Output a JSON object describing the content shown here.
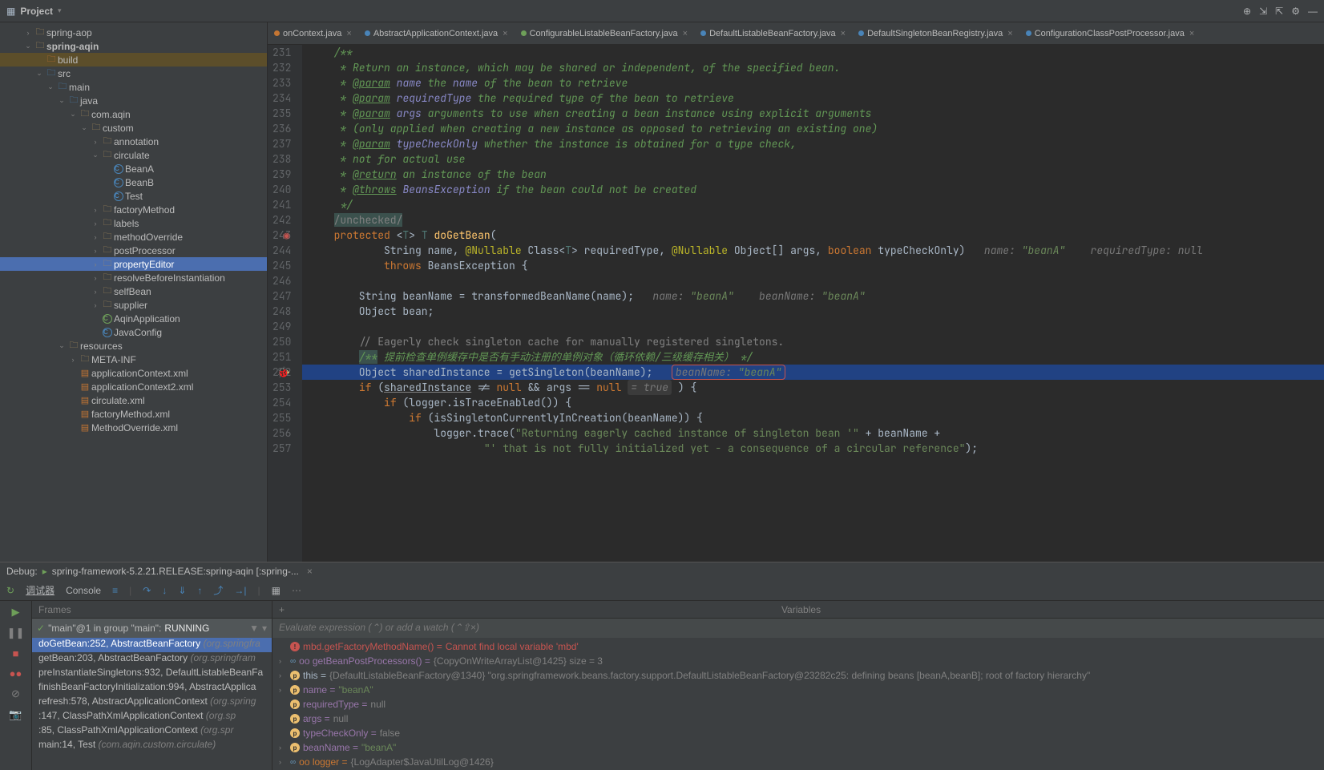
{
  "toolbar": {
    "project_label": "Project"
  },
  "tree": {
    "items": [
      {
        "indent": 2,
        "chev": "›",
        "icon": "folder",
        "label": "spring-aop",
        "cls": ""
      },
      {
        "indent": 2,
        "chev": "⌄",
        "icon": "folder",
        "label": "spring-aqin",
        "cls": "",
        "bold": true
      },
      {
        "indent": 3,
        "chev": "",
        "icon": "folder-o",
        "label": "build",
        "cls": "build"
      },
      {
        "indent": 3,
        "chev": "⌄",
        "icon": "folder-b",
        "label": "src",
        "cls": ""
      },
      {
        "indent": 4,
        "chev": "⌄",
        "icon": "folder-b",
        "label": "main",
        "cls": ""
      },
      {
        "indent": 5,
        "chev": "⌄",
        "icon": "folder-b",
        "label": "java",
        "cls": ""
      },
      {
        "indent": 6,
        "chev": "⌄",
        "icon": "folder",
        "label": "com.aqin",
        "cls": ""
      },
      {
        "indent": 7,
        "chev": "⌄",
        "icon": "folder",
        "label": "custom",
        "cls": ""
      },
      {
        "indent": 8,
        "chev": "›",
        "icon": "folder",
        "label": "annotation",
        "cls": ""
      },
      {
        "indent": 8,
        "chev": "⌄",
        "icon": "folder",
        "label": "circulate",
        "cls": ""
      },
      {
        "indent": 9,
        "chev": "",
        "icon": "class",
        "label": "BeanA",
        "cls": ""
      },
      {
        "indent": 9,
        "chev": "",
        "icon": "class",
        "label": "BeanB",
        "cls": ""
      },
      {
        "indent": 9,
        "chev": "",
        "icon": "class",
        "label": "Test",
        "cls": ""
      },
      {
        "indent": 8,
        "chev": "›",
        "icon": "folder",
        "label": "factoryMethod",
        "cls": ""
      },
      {
        "indent": 8,
        "chev": "›",
        "icon": "folder",
        "label": "labels",
        "cls": ""
      },
      {
        "indent": 8,
        "chev": "›",
        "icon": "folder",
        "label": "methodOverride",
        "cls": ""
      },
      {
        "indent": 8,
        "chev": "›",
        "icon": "folder",
        "label": "postProcessor",
        "cls": ""
      },
      {
        "indent": 8,
        "chev": "›",
        "icon": "folder",
        "label": "propertyEditor",
        "cls": "sel"
      },
      {
        "indent": 8,
        "chev": "›",
        "icon": "folder",
        "label": "resolveBeforeInstantiation",
        "cls": ""
      },
      {
        "indent": 8,
        "chev": "›",
        "icon": "folder",
        "label": "selfBean",
        "cls": ""
      },
      {
        "indent": 8,
        "chev": "›",
        "icon": "folder",
        "label": "supplier",
        "cls": ""
      },
      {
        "indent": 8,
        "chev": "",
        "icon": "class-g",
        "label": "AqinApplication",
        "cls": ""
      },
      {
        "indent": 8,
        "chev": "",
        "icon": "class",
        "label": "JavaConfig",
        "cls": ""
      },
      {
        "indent": 5,
        "chev": "⌄",
        "icon": "folder",
        "label": "resources",
        "cls": ""
      },
      {
        "indent": 6,
        "chev": "›",
        "icon": "folder",
        "label": "META-INF",
        "cls": ""
      },
      {
        "indent": 6,
        "chev": "",
        "icon": "xml",
        "label": "applicationContext.xml",
        "cls": ""
      },
      {
        "indent": 6,
        "chev": "",
        "icon": "xml",
        "label": "applicationContext2.xml",
        "cls": ""
      },
      {
        "indent": 6,
        "chev": "",
        "icon": "xml",
        "label": "circulate.xml",
        "cls": ""
      },
      {
        "indent": 6,
        "chev": "",
        "icon": "xml",
        "label": "factoryMethod.xml",
        "cls": ""
      },
      {
        "indent": 6,
        "chev": "",
        "icon": "xml",
        "label": "MethodOverride.xml",
        "cls": ""
      }
    ]
  },
  "tabs": [
    {
      "dot": "o",
      "label": "onContext.java"
    },
    {
      "dot": "b",
      "label": "AbstractApplicationContext.java"
    },
    {
      "dot": "g",
      "label": "ConfigurableListableBeanFactory.java"
    },
    {
      "dot": "b",
      "label": "DefaultListableBeanFactory.java"
    },
    {
      "dot": "b",
      "label": "DefaultSingletonBeanRegistry.java"
    },
    {
      "dot": "b",
      "label": "ConfigurationClassPostProcessor.java"
    }
  ],
  "code": {
    "first_line": 231,
    "breakpoint_line": 252,
    "lines": [
      "    /**",
      "     * Return an instance, which may be shared or independent, of the specified bean.",
      "     * @param name the name of the bean to retrieve",
      "     * @param requiredType the required type of the bean to retrieve",
      "     * @param args arguments to use when creating a bean instance using explicit arguments",
      "     * (only applied when creating a new instance as opposed to retrieving an existing one)",
      "     * @param typeCheckOnly whether the instance is obtained for a type check,",
      "     * not for actual use",
      "     * @return an instance of the bean",
      "     * @throws BeansException if the bean could not be created",
      "     */",
      "    /unchecked/",
      "    protected <T> T doGetBean(",
      "            String name, @Nullable Class<T> requiredType, @Nullable Object[] args, boolean typeCheckOnly)   name: \"beanA\"    requiredType: null",
      "            throws BeansException {",
      "",
      "        String beanName = transformedBeanName(name);   name: \"beanA\"    beanName: \"beanA\"",
      "        Object bean;",
      "",
      "        // Eagerly check singleton cache for manually registered singletons.",
      "        /** 提前检查单例缓存中是否有手动注册的单例对象（循环依赖/三级缓存相关） */",
      "        Object sharedInstance = getSingleton(beanName);   beanName: \"beanA\"",
      "        if (sharedInstance != null && args == null = true ) {",
      "            if (logger.isTraceEnabled()) {",
      "                if (isSingletonCurrentlyInCreation(beanName)) {",
      "                    logger.trace(\"Returning eagerly cached instance of singleton bean '\" + beanName +",
      "                            \"' that is not fully initialized yet - a consequence of a circular reference\");"
    ]
  },
  "debug": {
    "title": "spring-framework-5.2.21.RELEASE:spring-aqin [:spring-...",
    "tab_debugger": "调试器",
    "tab_console": "Console",
    "frames_hdr": "Frames",
    "vars_hdr": "Variables",
    "thread": {
      "name": "\"main\"@1 in group \"main\":",
      "status": "RUNNING"
    },
    "eval_placeholder": "Evaluate expression (⌃) or add a watch (⌃⇧×)",
    "frames": [
      {
        "main": "doGetBean:252, AbstractBeanFactory",
        "dim": "(org.springfra",
        "sel": true
      },
      {
        "main": "getBean:203, AbstractBeanFactory",
        "dim": "(org.springfram",
        "sel": false
      },
      {
        "main": "preInstantiateSingletons:932, DefaultListableBeanFa",
        "dim": "",
        "sel": false
      },
      {
        "main": "finishBeanFactoryInitialization:994, AbstractApplica",
        "dim": "",
        "sel": false
      },
      {
        "main": "refresh:578, AbstractApplicationContext",
        "dim": "(org.spring",
        "sel": false
      },
      {
        "main": "<init>:147, ClassPathXmlApplicationContext",
        "dim": "(org.sp",
        "sel": false
      },
      {
        "main": "<init>:85, ClassPathXmlApplicationContext",
        "dim": "(org.spr",
        "sel": false
      },
      {
        "main": "main:14, Test",
        "dim": "(com.aqin.custom.circulate)",
        "sel": false
      }
    ],
    "vars": [
      {
        "chev": "",
        "pill": "red",
        "name": "mbd.getFactoryMethodName() =",
        "ncls": "v-name-red",
        "val": "Cannot find local variable 'mbd'",
        "vcls": "v-err"
      },
      {
        "chev": "›",
        "pill": "",
        "name": "oo getBeanPostProcessors() =",
        "ncls": "v-name-purple",
        "val": "{CopyOnWriteArrayList@1425}  size = 3",
        "vcls": "v-val"
      },
      {
        "chev": "›",
        "pill": "orange",
        "name": "this =",
        "ncls": "",
        "val": "{DefaultListableBeanFactory@1340}  \"org.springframework.beans.factory.support.DefaultListableBeanFactory@23282c25: defining beans [beanA,beanB]; root of factory hierarchy\"",
        "vcls": "v-val"
      },
      {
        "chev": "›",
        "pill": "orange",
        "name": "name =",
        "ncls": "v-name-purple",
        "val": "\"beanA\"",
        "vcls": "v-str"
      },
      {
        "chev": "",
        "pill": "orange",
        "name": "requiredType =",
        "ncls": "v-name-purple",
        "val": "null",
        "vcls": "v-val"
      },
      {
        "chev": "",
        "pill": "orange",
        "name": "args =",
        "ncls": "v-name-purple",
        "val": "null",
        "vcls": "v-val"
      },
      {
        "chev": "",
        "pill": "orange",
        "name": "typeCheckOnly =",
        "ncls": "v-name-purple",
        "val": "false",
        "vcls": "v-val"
      },
      {
        "chev": "›",
        "pill": "orange",
        "name": "beanName =",
        "ncls": "v-name-purple",
        "val": "\"beanA\"",
        "vcls": "v-str"
      },
      {
        "chev": "›",
        "pill": "",
        "name": "oo logger =",
        "ncls": "v-name-orange",
        "val": "{LogAdapter$JavaUtilLog@1426}",
        "vcls": "v-val"
      }
    ]
  }
}
